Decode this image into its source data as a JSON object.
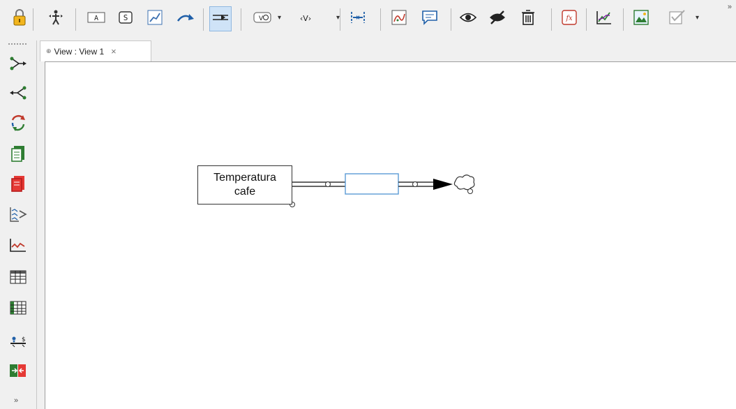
{
  "toolbar": {
    "buttons": [
      {
        "name": "lock-icon"
      },
      {
        "name": "move-pan-icon"
      },
      {
        "name": "variable-box-icon",
        "text": "A"
      },
      {
        "name": "stock-box-icon",
        "text": "S"
      },
      {
        "name": "line-graph-icon"
      },
      {
        "name": "arrow-icon"
      },
      {
        "name": "flow-rate-icon"
      },
      {
        "name": "shadow-variable-icon",
        "text": "V"
      },
      {
        "name": "angle-variable-icon",
        "text": "‹V›"
      },
      {
        "name": "merge-icon"
      },
      {
        "name": "sketch-graph-icon"
      },
      {
        "name": "comment-icon"
      },
      {
        "name": "show-eye-icon"
      },
      {
        "name": "hide-eye-icon"
      },
      {
        "name": "delete-trash-icon"
      },
      {
        "name": "function-icon",
        "text": "fx"
      },
      {
        "name": "sensitivity-graph-icon"
      },
      {
        "name": "image-icon"
      },
      {
        "name": "checklist-icon"
      }
    ],
    "more_label": "»"
  },
  "sidebar": {
    "buttons": [
      {
        "name": "causes-tree-icon"
      },
      {
        "name": "uses-tree-icon"
      },
      {
        "name": "loops-icon"
      },
      {
        "name": "document-icon"
      },
      {
        "name": "document-red-icon"
      },
      {
        "name": "causes-strip-icon"
      },
      {
        "name": "graph-icon"
      },
      {
        "name": "table-icon"
      },
      {
        "name": "table-time-down-icon"
      },
      {
        "name": "balance-icon"
      },
      {
        "name": "runs-compare-icon"
      }
    ],
    "more_label": "»"
  },
  "tab": {
    "icon": "ͦ⁸",
    "label": "View : View 1",
    "close": "×"
  },
  "diagram": {
    "stock_label": "Temperatura\ncafe",
    "colors": {
      "rate_box_border": "#5b9bd5",
      "lines": "#333333"
    }
  }
}
